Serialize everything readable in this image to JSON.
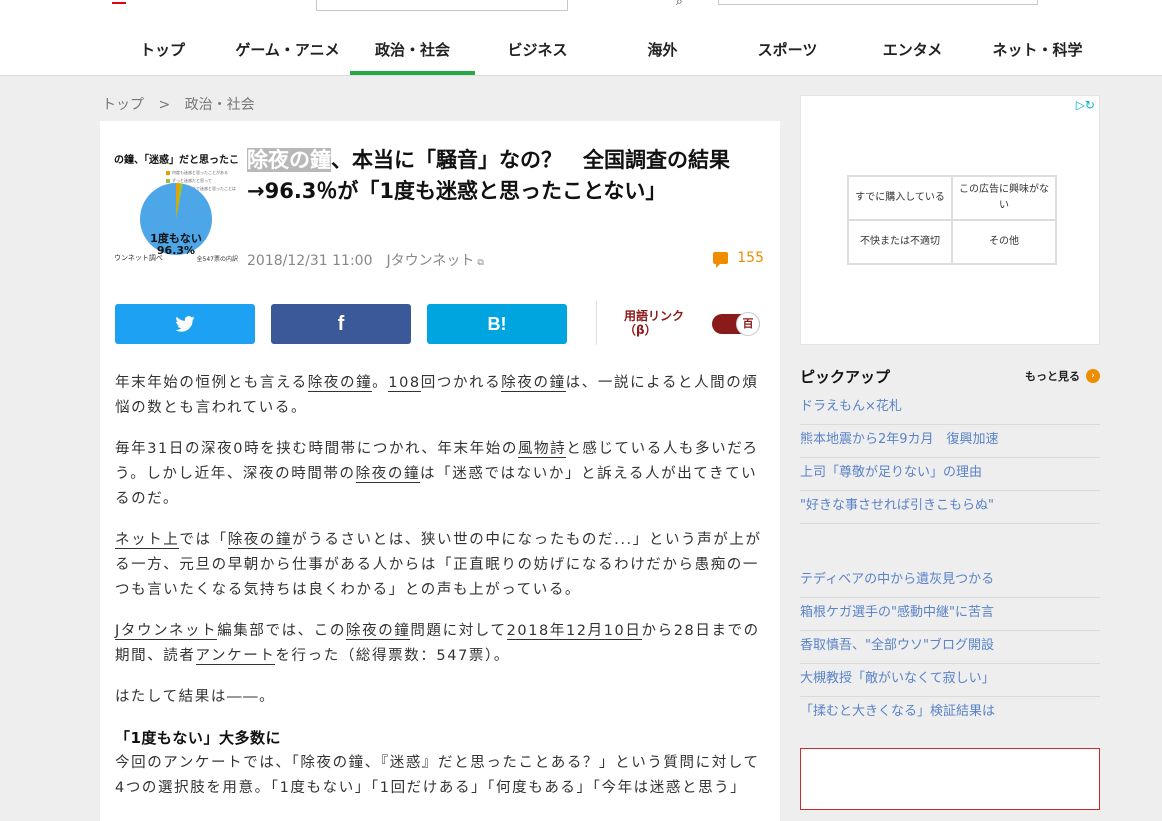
{
  "nav": [
    "トップ",
    "ゲーム・アニメ",
    "政治・社会",
    "ビジネス",
    "海外",
    "スポーツ",
    "エンタメ",
    "ネット・科学"
  ],
  "breadcrumb": {
    "home": "トップ",
    "sep": ">",
    "current": "政治・社会"
  },
  "thumbnail": {
    "title": "の鐘、「迷惑」だと思ったこと",
    "legend": [
      "何度も迷惑と思ったことがある",
      "ずっと迷惑だと思って",
      "今回の年末まで迷惑と思ったことはない"
    ],
    "pie_label_1": "1度もない",
    "pie_label_2": "96.3%",
    "source_left": "ウンネット調べ",
    "source_right": "全547票の内訳"
  },
  "article": {
    "headline_highlight": "除夜の鐘",
    "headline_rest": "、本当に「騒音」なの？　全国調査の結果→96.3％が「1度も迷惑と思ったことない」",
    "date": "2018/12/31 11:00",
    "source": "Jタウンネット",
    "comments": "155",
    "share_facebook": "f",
    "share_hatena": "B!",
    "term_link": "用語リンク",
    "term_link_beta": "（β）",
    "toggle_icon": "百",
    "p1": [
      "年末年始の恒例とも言える",
      "除夜の鐘",
      "。",
      "108",
      "回つかれる",
      "除夜の鐘",
      "は、一説によると人間の煩悩の数とも言われている。"
    ],
    "p2": [
      "毎年31日の深夜0時を挟む時間帯につかれ、年末年始の",
      "風物詩",
      "と感じている人も多いだろう。しかし近年、深夜の時間帯の",
      "除夜の鐘",
      "は「迷惑ではないか」と訴える人が出てきているのだ。"
    ],
    "p3": [
      "ネット上",
      "では「",
      "除夜の鐘",
      "がうるさいとは、狭い世の中になったものだ...」という声が上がる一方、元旦の早朝から仕事がある人からは「正直眠りの妨げになるわけだから愚痴の一つも言いたくなる気持ちは良くわかる」との声も上がっている。"
    ],
    "p4": [
      "Jタウンネット",
      "編集部では、この",
      "除夜の鐘",
      "問題に対して",
      "2018年",
      "12月10日",
      "から28日までの期間、読者",
      "アンケート",
      "を行った（総得票数：547票）。"
    ],
    "p5": "はたして結果は――。",
    "subhead": "「1度もない」大多数に",
    "p6": "今回のアンケートでは、「除夜の鐘、『迷惑』だと思ったことある？」という質問に対して4つの選択肢を用意。「1度もない」「1回だけある」「何度もある」「今年は迷惑と思う」"
  },
  "ad": {
    "cells": [
      "すでに購入している",
      "この広告に興味がない",
      "不快または不適切",
      "その他"
    ]
  },
  "pickup": {
    "title": "ピックアップ",
    "more": "もっと見る",
    "group1": [
      "ドラえもん×花札",
      "熊本地震から2年9カ月　復興加速",
      "上司「尊敬が足りない」の理由",
      "\"好きな事させれば引きこもらぬ\""
    ],
    "group2": [
      "テディベアの中から遺灰見つかる",
      "箱根ケガ選手の\"感動中継\"に苦言",
      "香取慎吾、\"全部ウソ\"ブログ開設",
      "大槻教授「敵がいなくて寂しい」",
      "「揉むと大きくなる」検証結果は"
    ]
  },
  "colors": {
    "nav_active": "#27a844",
    "twitter": "#1da1f2",
    "facebook": "#3b5998",
    "hatena": "#00a4de",
    "comment_orange": "#f08c00",
    "link_blue": "#5a83c8",
    "term_red": "#8b1a1a"
  },
  "icons": [
    "search-icon",
    "twitter-icon",
    "comment-icon",
    "external-link-icon",
    "chevron-right-icon",
    "adchoices-icon"
  ]
}
